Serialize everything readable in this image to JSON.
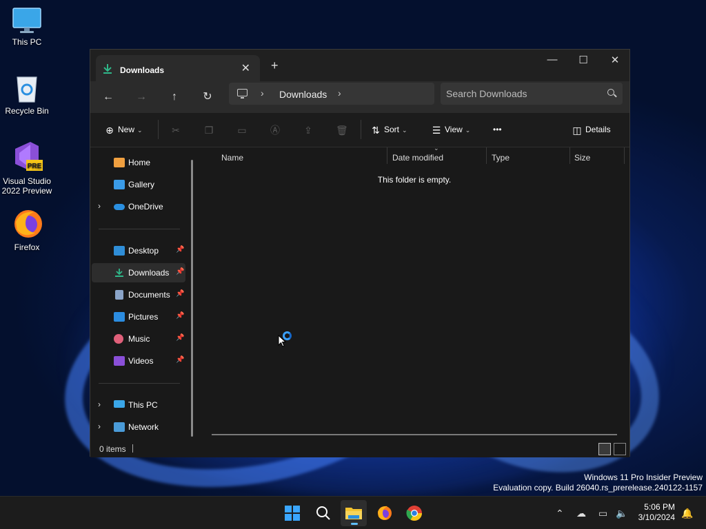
{
  "desktop": {
    "icons": [
      {
        "label": "This PC"
      },
      {
        "label": "Recycle Bin"
      },
      {
        "label": "Visual Studio 2022 Preview",
        "badge": "PRE"
      },
      {
        "label": "Firefox"
      }
    ],
    "watermark": {
      "line1": "Windows 11 Pro Insider Preview",
      "line2": "Evaluation copy. Build 26040.rs_prerelease.240122-1157"
    }
  },
  "explorer": {
    "tab_title": "Downloads",
    "window_controls": {
      "minimize": "—",
      "maximize": "☐",
      "close": "✕"
    },
    "breadcrumb": [
      "Downloads"
    ],
    "search": {
      "placeholder": "Search Downloads"
    },
    "commands": {
      "new_label": "New",
      "sort_label": "Sort",
      "view_label": "View",
      "more_label": "•••",
      "details_label": "Details"
    },
    "nav": {
      "quick": [
        {
          "label": "Home"
        },
        {
          "label": "Gallery"
        },
        {
          "label": "OneDrive"
        }
      ],
      "pinned": [
        {
          "label": "Desktop"
        },
        {
          "label": "Downloads"
        },
        {
          "label": "Documents"
        },
        {
          "label": "Pictures"
        },
        {
          "label": "Music"
        },
        {
          "label": "Videos"
        }
      ],
      "devices": [
        {
          "label": "This PC"
        },
        {
          "label": "Network"
        }
      ]
    },
    "columns": [
      "Name",
      "Date modified",
      "Type",
      "Size"
    ],
    "empty_message": "This folder is empty.",
    "status": {
      "item_count": "0 items"
    }
  },
  "taskbar": {
    "clock": {
      "time": "5:06 PM",
      "date": "3/10/2024"
    }
  },
  "colors": {
    "accent": "#60c0ff",
    "window_bg": "#191919",
    "titlebar_bg": "#202020",
    "download_green": "#2fb88a"
  }
}
